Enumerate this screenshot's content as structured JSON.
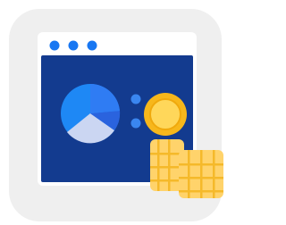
{
  "app_icon": {
    "icon": "finance-dashboard-icon",
    "description_role": "app-launcher-tile",
    "colors": {
      "tile_background": "#efefef",
      "window_frame": "#ffffff",
      "window_body": "#133b8f",
      "window_dots": "#1877f2",
      "pie_primary": "#1e88f5",
      "pie_secondary": "#2a63de",
      "pie_light": "#cbd6f2",
      "indicator_dots": "#3a86f0",
      "coin_gold": "#f7b71b",
      "coin_light": "#ffd75a",
      "coin_stack": "#ffd36b",
      "coin_stack_dark": "#f5b92a"
    },
    "elements": {
      "window": "app-window",
      "titlebar_dots": [
        "window-dot",
        "window-dot",
        "window-dot"
      ],
      "chart": "pie-chart-icon",
      "list_dots": [
        "indicator-dot",
        "indicator-dot"
      ],
      "coin": "coin-icon",
      "coin_stack": "coin-stack-icon"
    }
  }
}
